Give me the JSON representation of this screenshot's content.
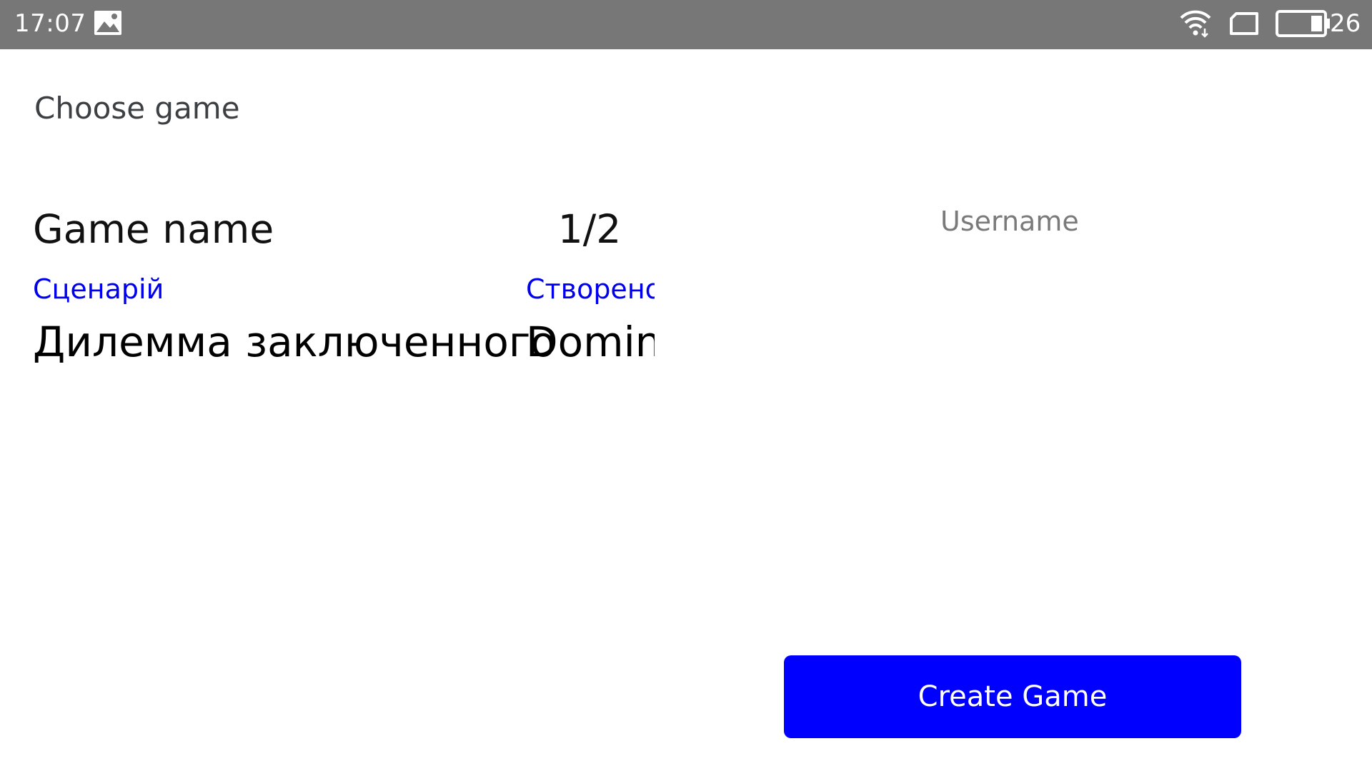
{
  "status_bar": {
    "time": "17:07",
    "battery_level": "26",
    "icons": [
      "photo-icon",
      "wifi-icon",
      "sim-icon",
      "battery-icon"
    ]
  },
  "page": {
    "title": "Choose game"
  },
  "table": {
    "game_name_header": "Game name",
    "players_header": "1/2"
  },
  "username": {
    "placeholder": "Username",
    "value": ""
  },
  "game_rows": [
    {
      "scenario_label": "Сценарій",
      "created_label": "Створено",
      "scenario_name": "Дилемма заключенного",
      "creator_name": "Domin"
    }
  ],
  "actions": {
    "create_game_label": "Create Game"
  },
  "colors": {
    "status_bar": "#777777",
    "link_blue": "#0000ee",
    "button_blue": "#0000ff"
  }
}
